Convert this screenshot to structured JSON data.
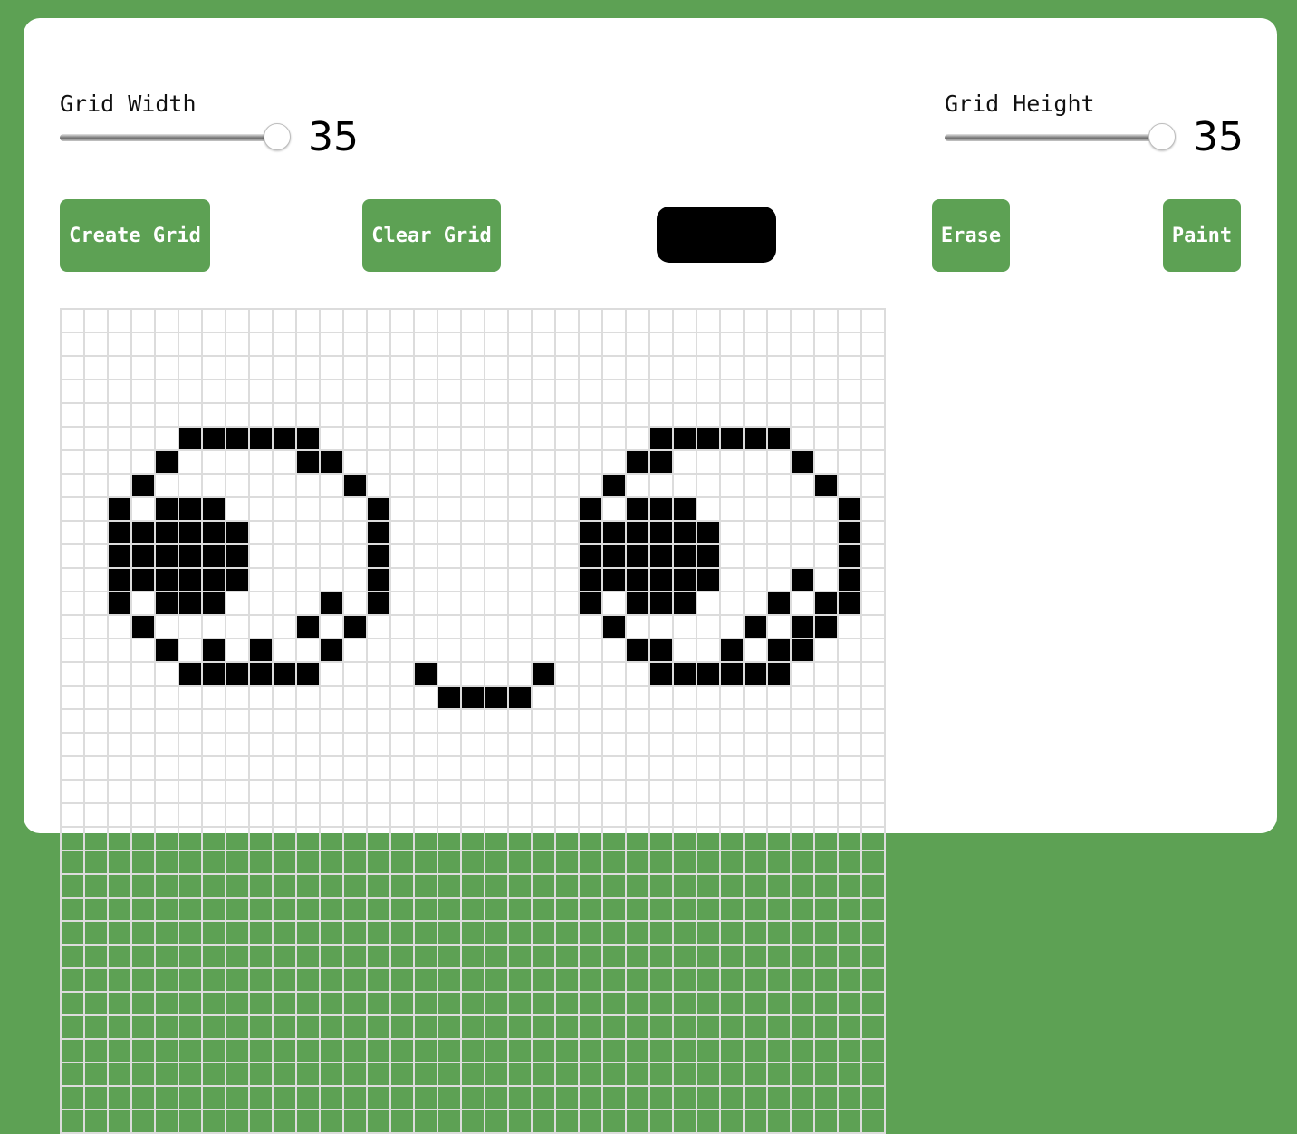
{
  "controls": {
    "grid_width_label": "Grid Width",
    "grid_width_value": 35,
    "grid_height_label": "Grid Height",
    "grid_height_value": 35,
    "slider_min": 1,
    "slider_max": 35
  },
  "buttons": {
    "create_label": "Create Grid",
    "clear_label": "Clear Grid",
    "erase_label": "Erase",
    "paint_label": "Paint"
  },
  "colors": {
    "background": "#5da154",
    "button": "#5da154",
    "selected_color": "#000000",
    "cell_border": "#dcdcdc",
    "filled_cell": "#000000"
  },
  "grid": {
    "columns": 35,
    "rows": 35,
    "filled_rows": [
      {
        "row": 5,
        "cols": [
          5,
          6,
          7,
          8,
          9,
          10,
          25,
          26,
          27,
          28,
          29,
          30
        ]
      },
      {
        "row": 6,
        "cols": [
          4,
          10,
          11,
          24,
          25,
          31
        ]
      },
      {
        "row": 7,
        "cols": [
          3,
          12,
          23,
          32
        ]
      },
      {
        "row": 8,
        "cols": [
          2,
          4,
          5,
          6,
          13,
          22,
          24,
          25,
          26,
          33
        ]
      },
      {
        "row": 9,
        "cols": [
          2,
          3,
          4,
          5,
          6,
          7,
          13,
          22,
          23,
          24,
          25,
          26,
          27,
          33
        ]
      },
      {
        "row": 10,
        "cols": [
          2,
          3,
          4,
          5,
          6,
          7,
          13,
          22,
          23,
          24,
          25,
          26,
          27,
          33
        ]
      },
      {
        "row": 11,
        "cols": [
          2,
          3,
          4,
          5,
          6,
          7,
          13,
          22,
          23,
          24,
          25,
          26,
          27,
          31,
          33
        ]
      },
      {
        "row": 12,
        "cols": [
          2,
          4,
          5,
          6,
          11,
          13,
          22,
          24,
          25,
          26,
          30,
          32,
          33
        ]
      },
      {
        "row": 13,
        "cols": [
          3,
          10,
          12,
          23,
          29,
          31,
          32
        ]
      },
      {
        "row": 14,
        "cols": [
          4,
          6,
          8,
          11,
          24,
          25,
          28,
          30,
          31
        ]
      },
      {
        "row": 15,
        "cols": [
          5,
          6,
          7,
          8,
          9,
          10,
          15,
          20,
          25,
          26,
          27,
          28,
          29,
          30
        ]
      },
      {
        "row": 16,
        "cols": [
          16,
          17,
          18,
          19
        ]
      }
    ]
  }
}
